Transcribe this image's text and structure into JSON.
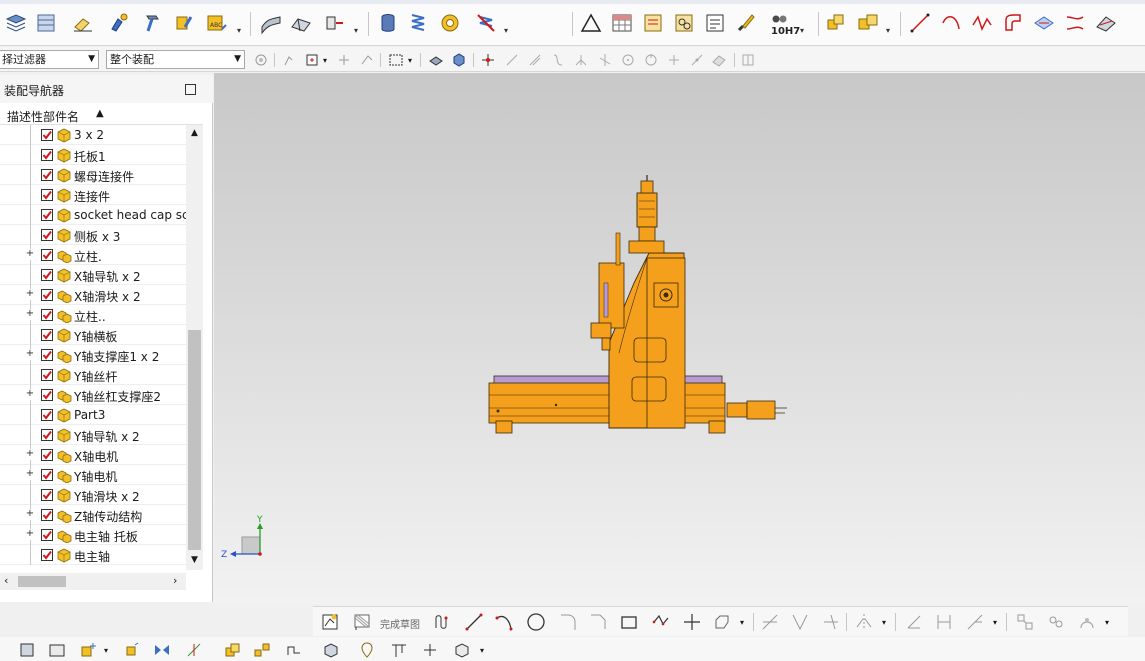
{
  "selection_bar": {
    "filter_value": "择过滤器",
    "scope_value": "整个装配"
  },
  "navigator": {
    "title": "装配导航器",
    "column_header": "描述性部件名",
    "sort_indicator": "▲",
    "items": [
      {
        "label": "3 x 2",
        "type": "part",
        "expandable": false,
        "checked": true
      },
      {
        "label": "托板1",
        "type": "part",
        "expandable": false,
        "checked": true
      },
      {
        "label": "螺母连接件",
        "type": "part",
        "expandable": false,
        "checked": true
      },
      {
        "label": "连接件",
        "type": "part",
        "expandable": false,
        "checked": true
      },
      {
        "label": "socket head cap sc",
        "type": "part",
        "expandable": false,
        "checked": true
      },
      {
        "label": "侧板 x 3",
        "type": "part",
        "expandable": false,
        "checked": true
      },
      {
        "label": "立柱.",
        "type": "assembly",
        "expandable": true,
        "checked": true
      },
      {
        "label": "X轴导轨 x 2",
        "type": "part",
        "expandable": false,
        "checked": true
      },
      {
        "label": "X轴滑块 x 2",
        "type": "assembly",
        "expandable": true,
        "checked": true
      },
      {
        "label": "立柱..",
        "type": "assembly",
        "expandable": true,
        "checked": true
      },
      {
        "label": "Y轴横板",
        "type": "part",
        "expandable": false,
        "checked": true
      },
      {
        "label": "Y轴支撑座1 x 2",
        "type": "assembly",
        "expandable": true,
        "checked": true
      },
      {
        "label": "Y轴丝杆",
        "type": "part",
        "expandable": false,
        "checked": true
      },
      {
        "label": "Y轴丝杠支撑座2",
        "type": "assembly",
        "expandable": true,
        "checked": true
      },
      {
        "label": "Part3",
        "type": "part",
        "expandable": false,
        "checked": true
      },
      {
        "label": "Y轴导轨 x 2",
        "type": "part",
        "expandable": false,
        "checked": true
      },
      {
        "label": "X轴电机",
        "type": "assembly",
        "expandable": true,
        "checked": true
      },
      {
        "label": "Y轴电机",
        "type": "assembly",
        "expandable": true,
        "checked": true
      },
      {
        "label": "Y轴滑块 x 2",
        "type": "part",
        "expandable": false,
        "checked": true
      },
      {
        "label": "Z轴传动结构",
        "type": "assembly",
        "expandable": true,
        "checked": true
      },
      {
        "label": "电主轴 托板",
        "type": "assembly",
        "expandable": true,
        "checked": true
      },
      {
        "label": "电主轴",
        "type": "part",
        "expandable": false,
        "checked": true
      }
    ]
  },
  "ribbon": {
    "fit_label": "10H7"
  },
  "bottom_toolbar": {
    "finish_sketch_label": "完成草图"
  },
  "triad": {
    "x_label": "Z",
    "y_label": "Y"
  },
  "colors": {
    "model_orange": "#f5a01c",
    "model_edge": "#3a2a10",
    "check_red": "#d01818",
    "part_yellow": "#f2c026"
  }
}
